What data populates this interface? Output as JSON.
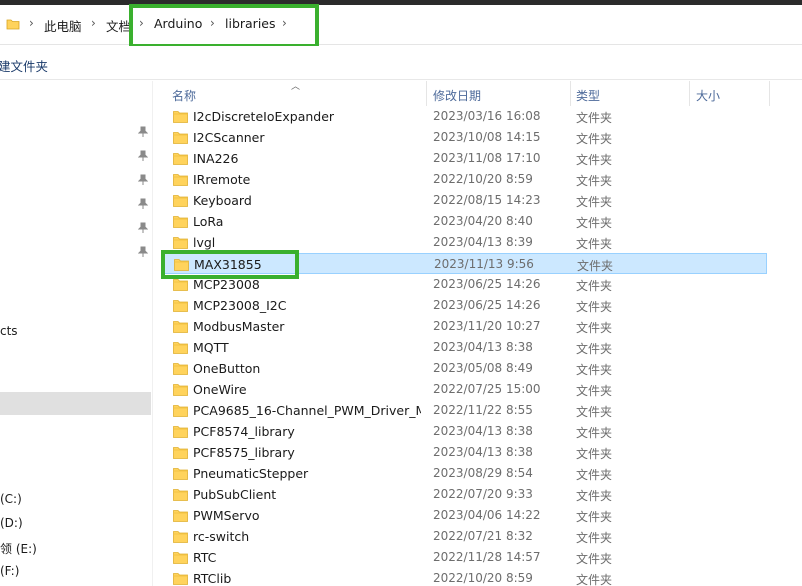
{
  "address_bar": {
    "crumbs": [
      "此电脑",
      "文档",
      "Arduino",
      "libraries"
    ],
    "separator": "›"
  },
  "toolbar": {
    "new_folder_label": "建文件夹"
  },
  "nav": {
    "items": [
      "cts",
      "(C:)",
      "(D:)",
      "领 (E:)",
      "(F:)"
    ]
  },
  "columns": {
    "name": "名称",
    "date": "修改日期",
    "type": "类型",
    "size": "大小"
  },
  "files": [
    {
      "name": "I2cDiscreteIoExpander",
      "date": "2023/03/16 16:08",
      "type": "文件夹"
    },
    {
      "name": "I2CScanner",
      "date": "2023/10/08 14:15",
      "type": "文件夹"
    },
    {
      "name": "INA226",
      "date": "2023/11/08 17:10",
      "type": "文件夹"
    },
    {
      "name": "IRremote",
      "date": "2022/10/20 8:59",
      "type": "文件夹"
    },
    {
      "name": "Keyboard",
      "date": "2022/08/15 14:23",
      "type": "文件夹"
    },
    {
      "name": "LoRa",
      "date": "2023/04/20 8:40",
      "type": "文件夹"
    },
    {
      "name": "lvgl",
      "date": "2023/04/13 8:39",
      "type": "文件夹"
    },
    {
      "name": "MAX31855",
      "date": "2023/11/13 9:56",
      "type": "文件夹",
      "selected": true
    },
    {
      "name": "MCP23008",
      "date": "2023/06/25 14:26",
      "type": "文件夹"
    },
    {
      "name": "MCP23008_I2C",
      "date": "2023/06/25 14:26",
      "type": "文件夹"
    },
    {
      "name": "ModbusMaster",
      "date": "2023/11/20 10:27",
      "type": "文件夹"
    },
    {
      "name": "MQTT",
      "date": "2023/04/13 8:38",
      "type": "文件夹"
    },
    {
      "name": "OneButton",
      "date": "2023/05/08 8:49",
      "type": "文件夹"
    },
    {
      "name": "OneWire",
      "date": "2022/07/25 15:00",
      "type": "文件夹"
    },
    {
      "name": "PCA9685_16-Channel_PWM_Driver_M...",
      "date": "2022/11/22 8:55",
      "type": "文件夹"
    },
    {
      "name": "PCF8574_library",
      "date": "2023/04/13 8:38",
      "type": "文件夹"
    },
    {
      "name": "PCF8575_library",
      "date": "2023/04/13 8:38",
      "type": "文件夹"
    },
    {
      "name": "PneumaticStepper",
      "date": "2023/08/29 8:54",
      "type": "文件夹"
    },
    {
      "name": "PubSubClient",
      "date": "2022/07/20 9:33",
      "type": "文件夹"
    },
    {
      "name": "PWMServo",
      "date": "2023/04/06 14:22",
      "type": "文件夹"
    },
    {
      "name": "rc-switch",
      "date": "2022/07/21 8:32",
      "type": "文件夹"
    },
    {
      "name": "RTC",
      "date": "2022/11/28 14:57",
      "type": "文件夹"
    },
    {
      "name": "RTClib",
      "date": "2022/10/20 8:59",
      "type": "文件夹"
    }
  ],
  "colors": {
    "highlight_box": "#3ab02e",
    "selection_bg": "#cce8ff",
    "folder_yellow": "#ffd35c"
  }
}
